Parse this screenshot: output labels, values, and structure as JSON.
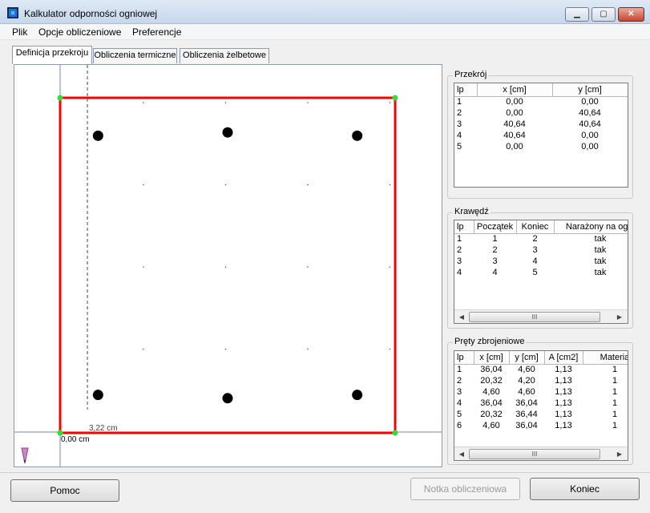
{
  "window": {
    "title": "Kalkulator odporności ogniowej",
    "min_glyph": "▁",
    "max_glyph": "▢",
    "close_glyph": "✕"
  },
  "menu": [
    "Plik",
    "Opcje obliczeniowe",
    "Preferencje"
  ],
  "tabs": [
    "Definicja przekroju",
    "Obliczenia termiczne",
    "Obliczenia żelbetowe"
  ],
  "canvas": {
    "offset_label": "3,22 cm",
    "origin_label": "0,00 cm",
    "border_color": "#ff0000",
    "node_color": "#33dd33",
    "rebar_color": "#000000"
  },
  "przekroj": {
    "title": "Przekrój",
    "headers": [
      "lp",
      "x [cm]",
      "y [cm]"
    ],
    "rows": [
      [
        "1",
        "0,00",
        "0,00"
      ],
      [
        "2",
        "0,00",
        "40,64"
      ],
      [
        "3",
        "40,64",
        "40,64"
      ],
      [
        "4",
        "40,64",
        "0,00"
      ],
      [
        "5",
        "0,00",
        "0,00"
      ]
    ]
  },
  "krawedz": {
    "title": "Krawędź",
    "headers": [
      "lp",
      "Początek",
      "Koniec",
      "Narażony na ogie"
    ],
    "rows": [
      [
        "1",
        "1",
        "2",
        "tak"
      ],
      [
        "2",
        "2",
        "3",
        "tak"
      ],
      [
        "3",
        "3",
        "4",
        "tak"
      ],
      [
        "4",
        "4",
        "5",
        "tak"
      ]
    ],
    "scroll": {
      "left": "◀",
      "thumb": "III",
      "right": "▶"
    }
  },
  "prety": {
    "title": "Pręty zbrojeniowe",
    "headers": [
      "lp",
      "x [cm]",
      "y [cm]",
      "A [cm2]",
      "Materia"
    ],
    "rows": [
      [
        "1",
        "36,04",
        "4,60",
        "1,13",
        "1"
      ],
      [
        "2",
        "20,32",
        "4,20",
        "1,13",
        "1"
      ],
      [
        "3",
        "4,60",
        "4,60",
        "1,13",
        "1"
      ],
      [
        "4",
        "36,04",
        "36,04",
        "1,13",
        "1"
      ],
      [
        "5",
        "20,32",
        "36,44",
        "1,13",
        "1"
      ],
      [
        "6",
        "4,60",
        "36,04",
        "1,13",
        "1"
      ]
    ],
    "scroll": {
      "left": "◀",
      "thumb": "III",
      "right": "▶"
    }
  },
  "buttons": {
    "help": "Pomoc",
    "note": "Notka obliczeniowa",
    "end": "Koniec"
  }
}
